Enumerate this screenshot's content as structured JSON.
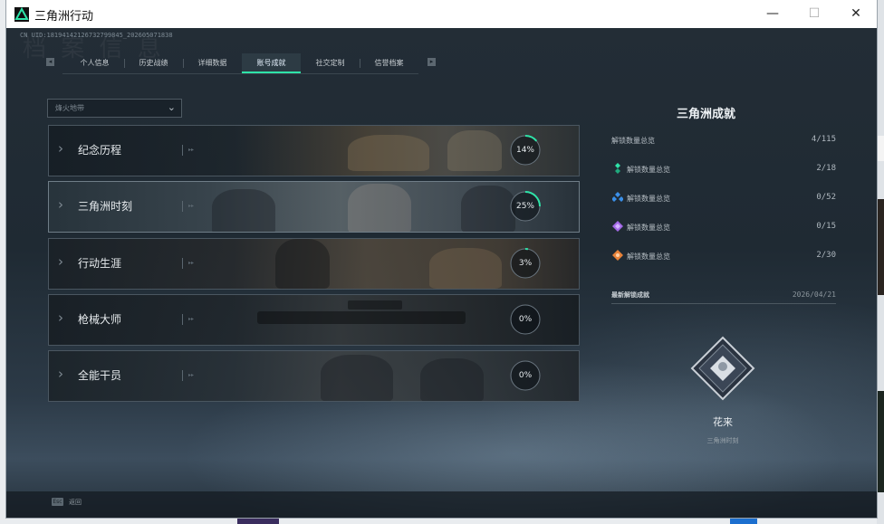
{
  "window": {
    "title": "三角洲行动"
  },
  "uid": "CN UID:18194142126732799845_202605071838",
  "bg_watermark": "档 案 信 息",
  "tabs": [
    "个人信息",
    "历史战绩",
    "详细数据",
    "账号成就",
    "社交定制",
    "信誉档案"
  ],
  "active_tab": "账号成就",
  "filter": {
    "placeholder": "烽火地带"
  },
  "categories": [
    {
      "name": "纪念历程",
      "percent": 14,
      "percent_label": "14%"
    },
    {
      "name": "三角洲时刻",
      "percent": 25,
      "percent_label": "25%"
    },
    {
      "name": "行动生涯",
      "percent": 3,
      "percent_label": "3%"
    },
    {
      "name": "枪械大师",
      "percent": 0,
      "percent_label": "0%"
    },
    {
      "name": "全能干员",
      "percent": 0,
      "percent_label": "0%"
    }
  ],
  "side": {
    "title": "三角洲成就",
    "summary": {
      "label": "解锁数量总览",
      "value": "4/115"
    },
    "tiers": [
      {
        "label": "解锁数量总览",
        "value": "2/18",
        "color": "#2fe3a8",
        "icon": "green-tier-icon"
      },
      {
        "label": "解锁数量总览",
        "value": "0/52",
        "color": "#3a8fe8",
        "icon": "blue-tier-icon"
      },
      {
        "label": "解锁数量总览",
        "value": "0/15",
        "color": "#a46ae8",
        "icon": "purple-tier-icon"
      },
      {
        "label": "解锁数量总览",
        "value": "2/30",
        "color": "#e8833a",
        "icon": "orange-tier-icon"
      }
    ],
    "recent": {
      "label": "最新解锁成就",
      "date": "2026/04/21",
      "badge_name": "花来",
      "badge_category": "三角洲时刻"
    }
  },
  "footer": {
    "key": "Esc",
    "label": "返回"
  },
  "accent_color": "#2fe3a8"
}
